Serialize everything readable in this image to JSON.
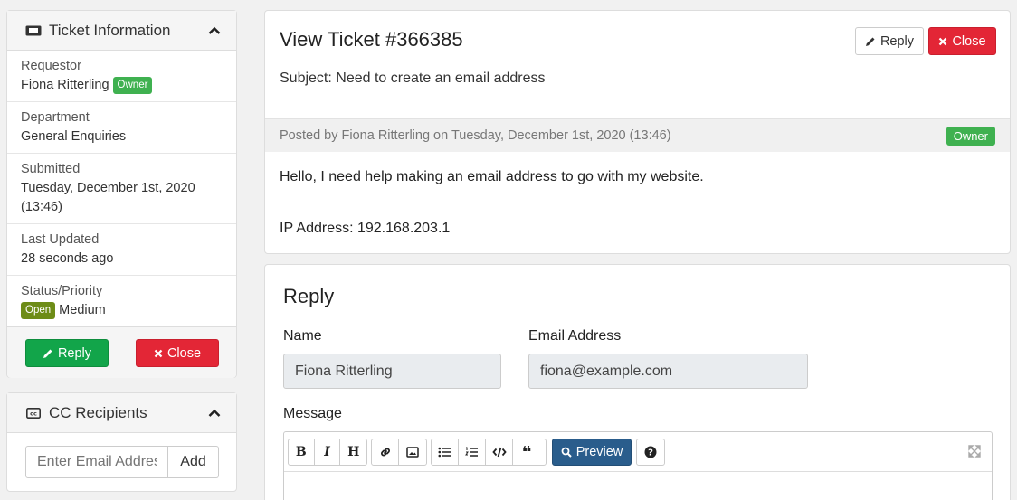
{
  "ticket_info": {
    "header": "Ticket Information",
    "requestor_label": "Requestor",
    "requestor_value": "Fiona Ritterling",
    "owner_badge": "Owner",
    "department_label": "Department",
    "department_value": "General Enquiries",
    "submitted_label": "Submitted",
    "submitted_value_line1": "Tuesday, December 1st, 2020",
    "submitted_value_line2": "(13:46)",
    "last_updated_label": "Last Updated",
    "last_updated_value": "28 seconds ago",
    "status_label": "Status/Priority",
    "status_badge": "Open",
    "priority_value": "Medium",
    "reply_button": "Reply",
    "close_button": "Close"
  },
  "cc": {
    "header": "CC Recipients",
    "email_placeholder": "Enter Email Address",
    "add_button": "Add"
  },
  "ticket": {
    "title": "View Ticket #366385",
    "subject": "Subject: Need to create an email address",
    "reply_button": "Reply",
    "close_button": "Close",
    "posted_by": "Posted by Fiona Ritterling on Tuesday, December 1st, 2020 (13:46)",
    "owner_badge": "Owner",
    "message": "Hello, I need help making an email address to go with my website.",
    "ip_address": "IP Address: 192.168.203.1"
  },
  "reply_form": {
    "title": "Reply",
    "name_label": "Name",
    "name_value": "Fiona Ritterling",
    "email_label": "Email Address",
    "email_value": "fiona@example.com",
    "message_label": "Message",
    "preview_button": "Preview"
  },
  "colors": {
    "green": "#12a54a",
    "red": "#e32636",
    "owner_badge": "#3fb150",
    "open_badge": "#6d8c17",
    "preview_blue": "#2a5d8c"
  }
}
